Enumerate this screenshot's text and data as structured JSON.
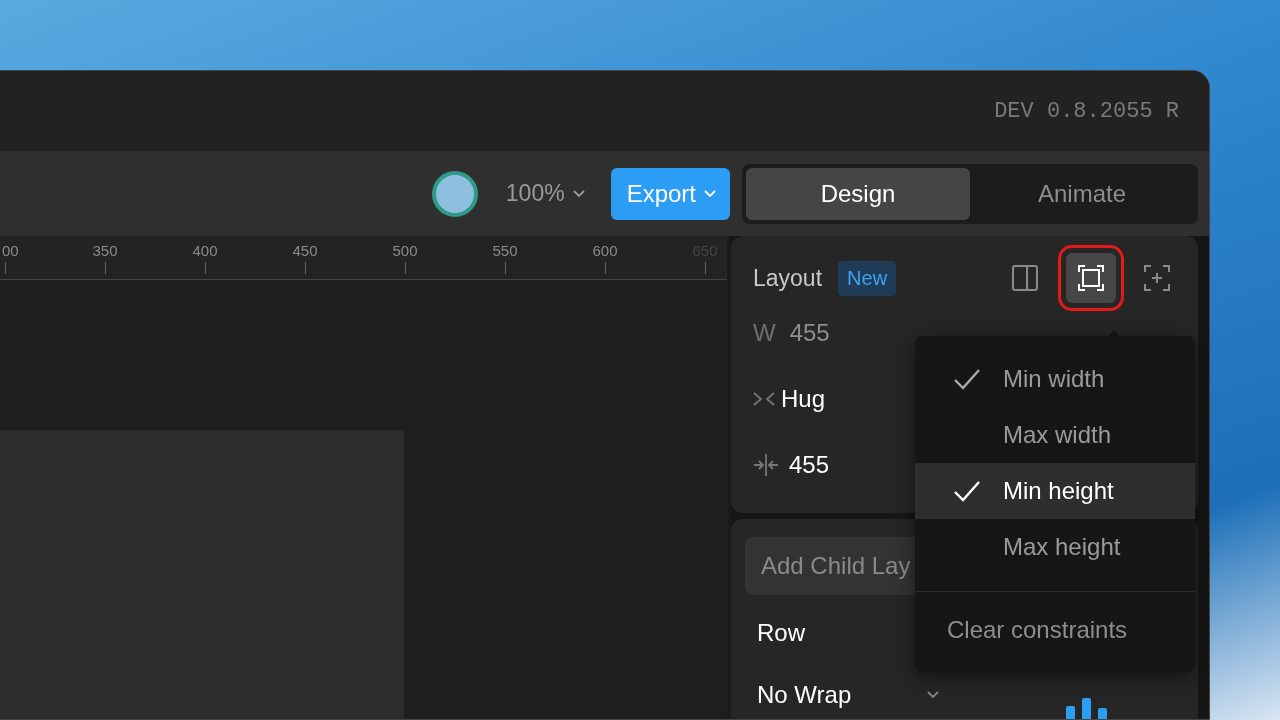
{
  "window": {
    "version": "DEV 0.8.2055 R"
  },
  "toolbar": {
    "zoom": "100%",
    "export_button": "Export",
    "tabs": [
      {
        "label": "Design",
        "selected": true
      },
      {
        "label": "Animate",
        "selected": false
      }
    ]
  },
  "ruler": {
    "labels": [
      "00",
      "350",
      "400",
      "450",
      "500",
      "550",
      "600",
      "650"
    ]
  },
  "layout_panel": {
    "title": "Layout",
    "badge": "New",
    "tools": [
      {
        "kind": "split",
        "selected": false,
        "highlighted": false
      },
      {
        "kind": "frame",
        "selected": true,
        "highlighted": true
      },
      {
        "kind": "add",
        "selected": false,
        "highlighted": false
      }
    ],
    "width_label": "W",
    "width_value": "455",
    "sizing": "Hug",
    "gap": "455"
  },
  "child_layout": {
    "placeholder": "Add Child Lay",
    "direction": "Row",
    "wrap": "No Wrap"
  },
  "constraints_menu": {
    "items": [
      {
        "label": "Min width",
        "checked": true,
        "selected": false
      },
      {
        "label": "Max width",
        "checked": false,
        "selected": false
      },
      {
        "label": "Min height",
        "checked": true,
        "selected": true
      },
      {
        "label": "Max height",
        "checked": false,
        "selected": false
      }
    ],
    "clear": "Clear constraints"
  }
}
